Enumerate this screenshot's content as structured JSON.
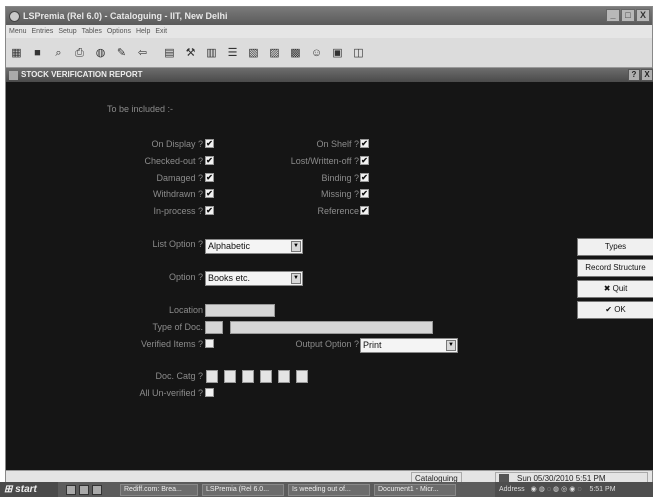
{
  "window": {
    "title": "LSPremia (Rel 6.0) - Cataloguing - IIT, New Delhi",
    "controls": [
      "_",
      "□",
      "X"
    ]
  },
  "menu": [
    "Menu",
    "Entries",
    "Setup",
    "Tables",
    "Options",
    "Help",
    "Exit"
  ],
  "toolbar": {
    "icons": [
      "calculator-icon",
      "notes-icon",
      "search-icon",
      "printer-icon",
      "globe-icon",
      "edit-icon",
      "back-arrow-icon",
      "document-icon",
      "tools-icon",
      "catalogue-icon",
      "list-icon",
      "chart-icon",
      "index-icon",
      "chart-icon",
      "users-icon",
      "report-icon",
      "dvd-icon"
    ]
  },
  "panel": {
    "title": "STOCK VERIFICATION REPORT",
    "controls": [
      "?",
      "X"
    ]
  },
  "form": {
    "heading": "To be included :-",
    "left_options": [
      {
        "label": "On Display ?",
        "checked": true
      },
      {
        "label": "Checked-out ?",
        "checked": true
      },
      {
        "label": "Damaged ?",
        "checked": true
      },
      {
        "label": "Withdrawn ?",
        "checked": true
      },
      {
        "label": "In-process ?",
        "checked": true
      }
    ],
    "right_options": [
      {
        "label": "On Shelf ?",
        "checked": true
      },
      {
        "label": "Lost/Written-off ?",
        "checked": true
      },
      {
        "label": "Binding ?",
        "checked": true
      },
      {
        "label": "Missing ?",
        "checked": true
      },
      {
        "label": "Reference",
        "checked": true
      }
    ],
    "list_option_label": "List Option ?",
    "list_option_value": "Alphabetic",
    "option_label": "Option ?",
    "option_value": "Books etc.",
    "location_label": "Location",
    "type_of_doc_label": "Type of Doc.",
    "verified_items_label": "Verified Items ?",
    "verified_items_checked": false,
    "output_option_label": "Output Option ?",
    "output_option_value": "Print",
    "doc_catg_label": "Doc. Catg ?",
    "all_unverified_label": "All Un-verified ?",
    "all_unverified_checked": false,
    "check_mark": "✔"
  },
  "side_buttons": {
    "types": "Types",
    "record_structure": "Record Structure",
    "quit": "Quit",
    "ok": "OK",
    "quit_icon": "✖",
    "ok_icon": "✔"
  },
  "status": {
    "module": "Cataloguing",
    "datetime": "Sun 05/30/2010 5:51 PM"
  },
  "taskbar": {
    "start": "start",
    "tasks": [
      "Rediff.com: Brea...",
      "LSPremia (Rel 6.0...",
      "Is weeding out of...",
      "Document1 - Micr..."
    ],
    "tray_address": "Address",
    "clock": "5:51 PM"
  }
}
